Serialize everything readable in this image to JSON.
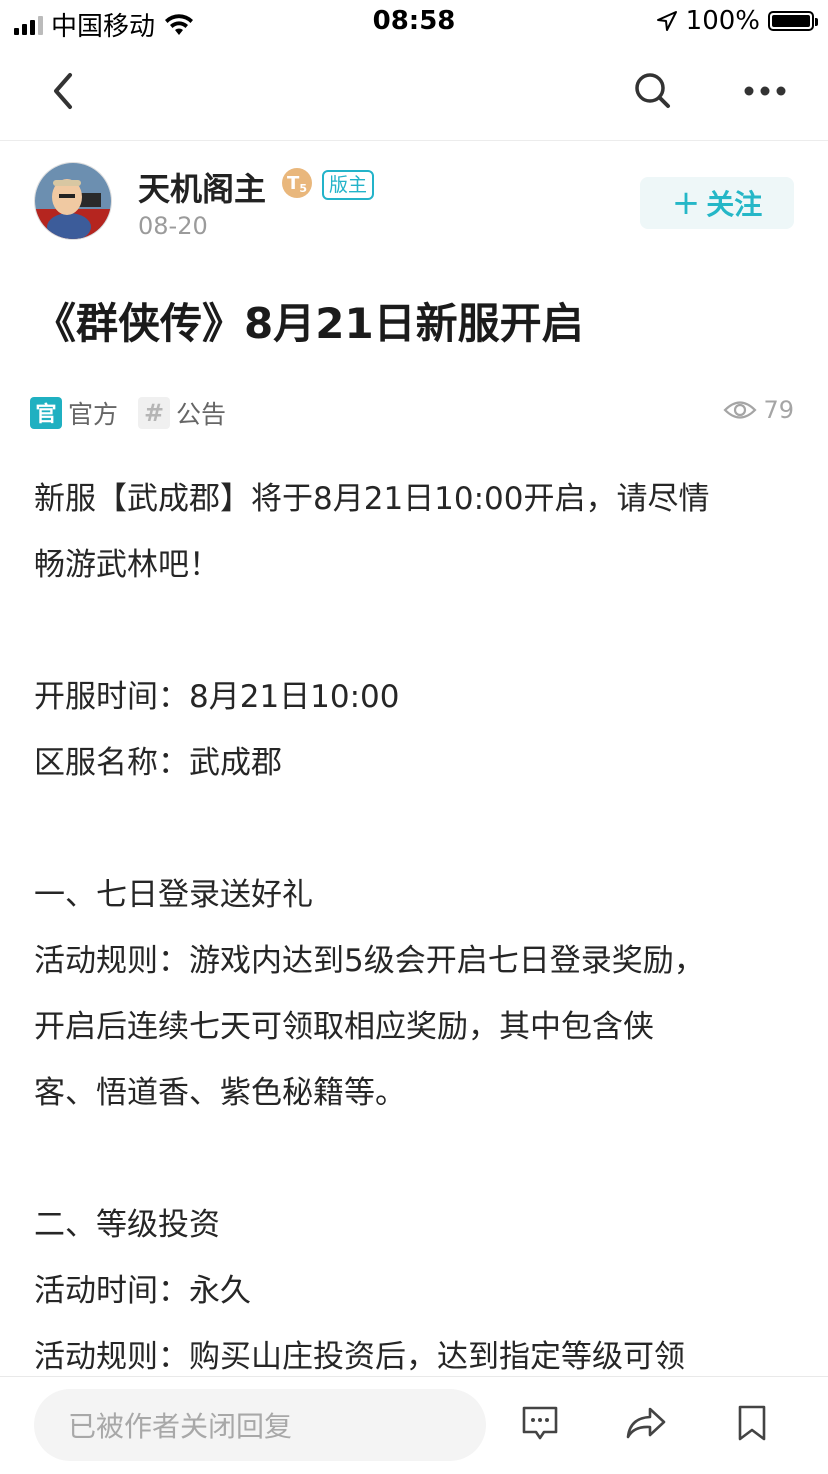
{
  "status_bar": {
    "carrier": "中国移动",
    "time": "08:58",
    "battery": "100%",
    "battery_level": 1.0,
    "icons": [
      "signal-icon",
      "wifi-icon",
      "location-arrow-icon",
      "battery-icon"
    ]
  },
  "nav": {
    "icons": [
      "back-icon",
      "search-icon",
      "more-icon"
    ]
  },
  "author": {
    "name": "天机阁主",
    "level_badge": "T",
    "level_number": "5",
    "role_badge": "版主",
    "date": "08-20",
    "follow_label": "关注",
    "follow_prefix": "+"
  },
  "post": {
    "title": "《群侠传》8月21日新服开启",
    "tags": [
      {
        "icon_text": "官",
        "label": "官方"
      },
      {
        "icon_text": "#",
        "label": "公告"
      }
    ],
    "views": "79",
    "paragraphs": [
      "新服【武成郡】将于8月21日10:00开启，请尽情",
      "畅游武林吧！",
      "",
      "开服时间：8月21日10:00",
      "区服名称：武成郡",
      "",
      "一、七日登录送好礼",
      "活动规则：游戏内达到5级会开启七日登录奖励，",
      "开启后连续七天可领取相应奖励，其中包含侠",
      "客、悟道香、紫色秘籍等。",
      "",
      "二、等级投资",
      "活动时间：永久",
      "活动规则：购买山庄投资后，达到指定等级可领"
    ]
  },
  "bottom_bar": {
    "reply_placeholder": "已被作者关闭回复",
    "icons": [
      "comment-icon",
      "share-icon",
      "bookmark-icon"
    ]
  },
  "colors": {
    "accent": "#25b7c7",
    "official_tag": "#1fb0c1",
    "level_badge": "#e9b77c"
  }
}
